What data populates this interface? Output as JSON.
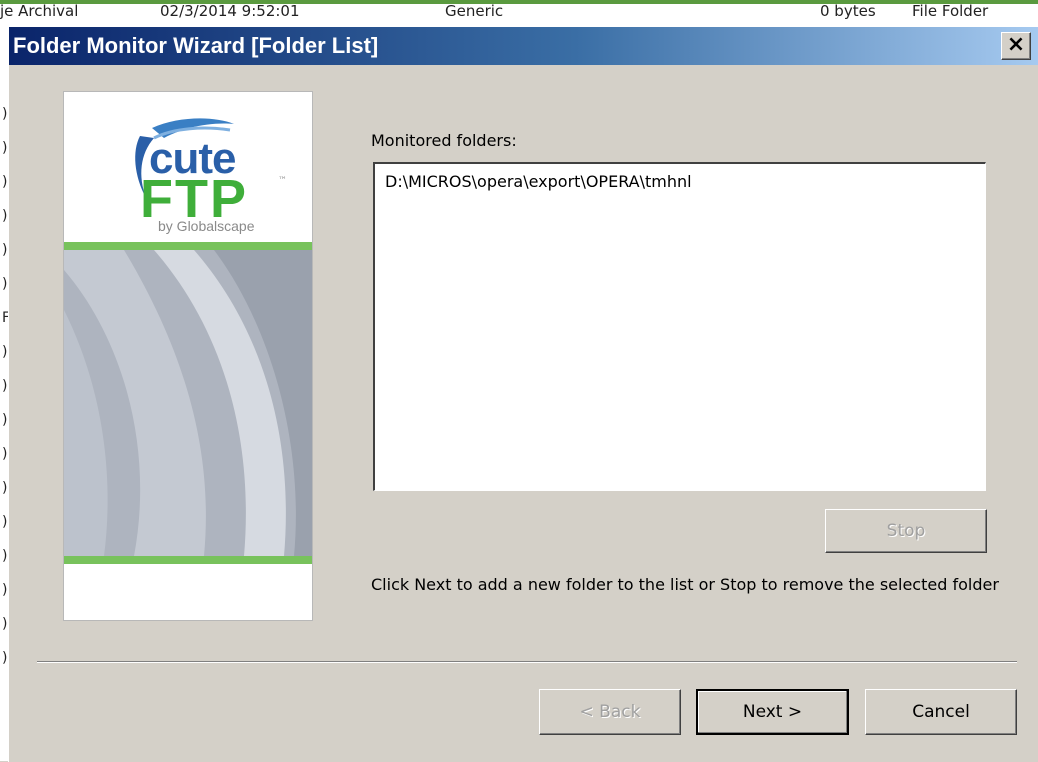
{
  "background": {
    "top_columns": [
      "je Archival",
      "02/3/2014 9:52:01",
      "Generic",
      "0 bytes",
      "File Folder"
    ],
    "left_marks": [
      ")",
      ")",
      ")",
      ")",
      ")",
      ")",
      "F",
      ")",
      ")",
      ")",
      ")",
      ")",
      ")",
      ")",
      ")",
      ")",
      ")"
    ]
  },
  "dialog": {
    "title": "Folder Monitor Wizard [Folder List]",
    "close_glyph": "×",
    "colors": {
      "title_start": "#0a246a",
      "title_end": "#a6caf0",
      "logo_green": "#3fae3a",
      "logo_blue": "#2a5fa8"
    }
  },
  "logo": {
    "word1": "cute",
    "word2": "FTP",
    "trademark": "™",
    "byline": "by Globalscape",
    "icon": "cuteftp-swoosh-icon"
  },
  "content": {
    "monitored_label": "Monitored folders:",
    "folders": [
      "D:\\MICROS\\opera\\export\\OPERA\\tmhnl"
    ],
    "stop_label": "Stop",
    "hint": "Click Next to add a new folder to the list or Stop to remove the selected folder"
  },
  "footer": {
    "back_label": "< Back",
    "next_label": "Next >",
    "cancel_label": "Cancel"
  }
}
